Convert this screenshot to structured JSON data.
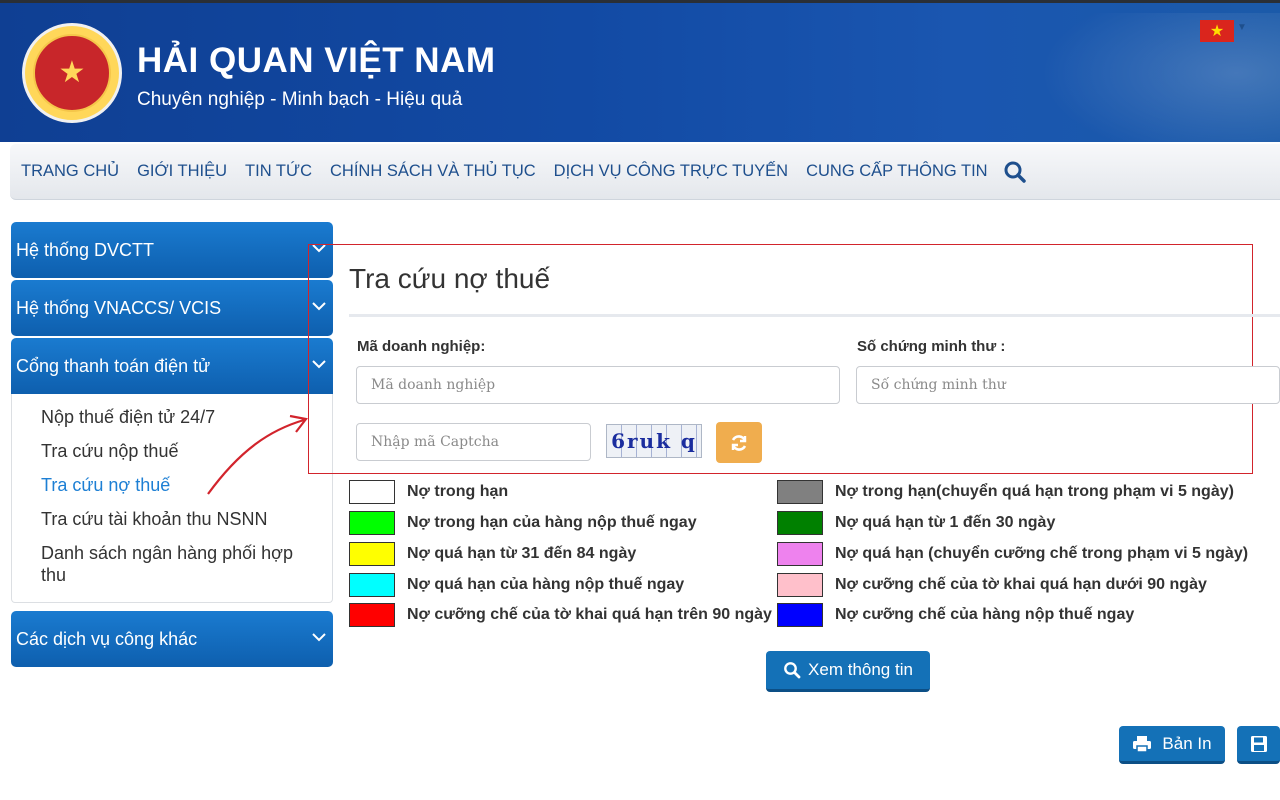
{
  "header": {
    "title": "HẢI QUAN VIỆT NAM",
    "subtitle": "Chuyên nghiệp - Minh bạch - Hiệu quả"
  },
  "nav": {
    "items": [
      "TRANG CHỦ",
      "GIỚI THIỆU",
      "TIN TỨC",
      "CHÍNH SÁCH VÀ THỦ TỤC",
      "DỊCH VỤ CÔNG TRỰC TUYẾN",
      "CUNG CẤP THÔNG TIN"
    ]
  },
  "sidebar": {
    "sections": [
      {
        "label": "Hệ thống DVCTT"
      },
      {
        "label": "Hệ thống VNACCS/ VCIS"
      },
      {
        "label": "Cổng thanh toán điện tử"
      },
      {
        "label": "Các dịch vụ công khác"
      }
    ],
    "links": [
      {
        "label": "Nộp thuế điện tử 24/7"
      },
      {
        "label": "Tra cứu nộp thuế"
      },
      {
        "label": "Tra cứu nợ thuế",
        "active": true
      },
      {
        "label": "Tra cứu tài khoản thu NSNN"
      },
      {
        "label": "Danh sách ngân hàng phối hợp thu"
      }
    ]
  },
  "main": {
    "title": "Tra cứu nợ thuế",
    "field_company_label": "Mã doanh nghiệp:",
    "field_company_placeholder": "Mã doanh nghiệp",
    "field_id_label": "Số chứng minh thư :",
    "field_id_placeholder": "Số chứng minh thư",
    "captcha_placeholder": "Nhập mã Captcha",
    "captcha_code": "6ruk q",
    "view_button": "Xem thông tin",
    "print_button": "Bản In"
  },
  "legend": [
    {
      "label": "Nợ trong hạn",
      "color": "#ffffff"
    },
    {
      "label": "Nợ trong hạn(chuyển quá hạn trong phạm vi 5 ngày)",
      "color": "#808080"
    },
    {
      "label": "Nợ trong hạn của hàng nộp thuế ngay",
      "color": "#00ff00"
    },
    {
      "label": "Nợ quá hạn từ 1 đến 30 ngày",
      "color": "#008000"
    },
    {
      "label": "Nợ quá hạn từ 31 đến 84 ngày",
      "color": "#ffff00"
    },
    {
      "label": "Nợ quá hạn (chuyển cưỡng chế trong phạm vi 5 ngày)",
      "color": "#ee82ee"
    },
    {
      "label": "Nợ quá hạn của hàng nộp thuế ngay",
      "color": "#00ffff"
    },
    {
      "label": "Nợ cưỡng chế của tờ khai quá hạn dưới 90 ngày",
      "color": "#ffc0cb"
    },
    {
      "label": "Nợ cưỡng chế của tờ khai quá hạn trên 90 ngày",
      "color": "#ff0000"
    },
    {
      "label": "Nợ cưỡng chế của hàng nộp thuế ngay",
      "color": "#0000ff"
    }
  ],
  "colors": {
    "header_blue": "#124aa4",
    "nav_text": "#1e4f8d",
    "sidebar_blue": "#1471b7",
    "highlight_red": "#d2242c",
    "refresh_orange": "#f0ad4e"
  }
}
